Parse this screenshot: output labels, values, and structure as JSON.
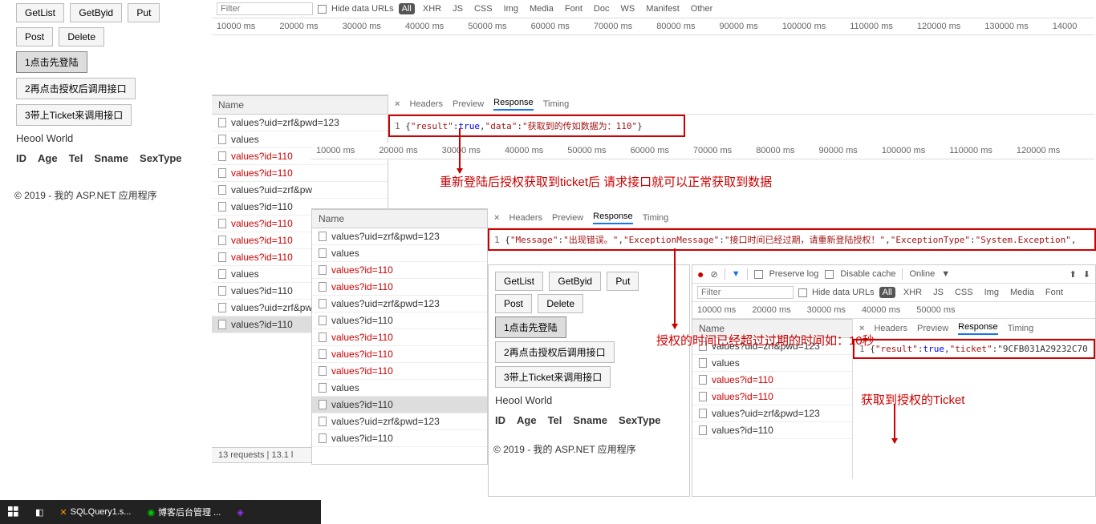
{
  "app": {
    "buttons": {
      "getlist": "GetList",
      "getbyid": "GetByid",
      "put": "Put",
      "post": "Post",
      "delete": "Delete",
      "step1": "1点击先登陆",
      "step2": "2再点击授权后调用接口",
      "step3": "3带上Ticket来调用接口"
    },
    "heool": "Heool World",
    "tbl_headers": [
      "ID",
      "Age",
      "Tel",
      "Sname",
      "SexType"
    ],
    "copyright": "© 2019 - 我的 ASP.NET 应用程序"
  },
  "filter": {
    "placeholder": "Filter",
    "hide_data_urls": "Hide data URLs",
    "types": [
      "All",
      "XHR",
      "JS",
      "CSS",
      "Img",
      "Media",
      "Font",
      "Doc",
      "WS",
      "Manifest",
      "Other"
    ]
  },
  "waterfall_main": [
    "10000 ms",
    "20000 ms",
    "30000 ms",
    "40000 ms",
    "50000 ms",
    "60000 ms",
    "70000 ms",
    "80000 ms",
    "90000 ms",
    "100000 ms",
    "110000 ms",
    "120000 ms",
    "130000 ms",
    "14000"
  ],
  "waterfall_mid": [
    "10000 ms",
    "20000 ms",
    "30000 ms",
    "40000 ms",
    "50000 ms",
    "60000 ms",
    "70000 ms",
    "80000 ms",
    "90000 ms",
    "100000 ms",
    "110000 ms",
    "120000 ms"
  ],
  "waterfall_sm": [
    "10000 ms",
    "20000 ms",
    "30000 ms",
    "40000 ms",
    "50000 ms"
  ],
  "name_label": "Name",
  "resp_tabs": {
    "close": "×",
    "headers": "Headers",
    "preview": "Preview",
    "response": "Response",
    "timing": "Timing"
  },
  "reqs_left": [
    {
      "t": "values?uid=zrf&pwd=123",
      "r": false,
      "sel": false
    },
    {
      "t": "values",
      "r": false,
      "sel": false
    },
    {
      "t": "values?id=110",
      "r": true,
      "sel": false
    },
    {
      "t": "values?id=110",
      "r": true,
      "sel": false
    },
    {
      "t": "values?uid=zrf&pw",
      "r": false,
      "sel": false
    },
    {
      "t": "values?id=110",
      "r": false,
      "sel": false
    },
    {
      "t": "values?id=110",
      "r": true,
      "sel": false
    },
    {
      "t": "values?id=110",
      "r": true,
      "sel": false
    },
    {
      "t": "values?id=110",
      "r": true,
      "sel": false
    },
    {
      "t": "values",
      "r": false,
      "sel": false
    },
    {
      "t": "values?id=110",
      "r": false,
      "sel": false
    },
    {
      "t": "values?uid=zrf&pw",
      "r": false,
      "sel": false
    },
    {
      "t": "values?id=110",
      "r": false,
      "sel": true
    }
  ],
  "status_left": "13 requests   |   13.1 l",
  "reqs_mid": [
    {
      "t": "values?uid=zrf&pwd=123",
      "r": false,
      "sel": false
    },
    {
      "t": "values",
      "r": false,
      "sel": false
    },
    {
      "t": "values?id=110",
      "r": true,
      "sel": false
    },
    {
      "t": "values?id=110",
      "r": true,
      "sel": false
    },
    {
      "t": "values?uid=zrf&pwd=123",
      "r": false,
      "sel": false
    },
    {
      "t": "values?id=110",
      "r": false,
      "sel": false
    },
    {
      "t": "values?id=110",
      "r": true,
      "sel": false
    },
    {
      "t": "values?id=110",
      "r": true,
      "sel": false
    },
    {
      "t": "values?id=110",
      "r": true,
      "sel": false
    },
    {
      "t": "values",
      "r": false,
      "sel": false
    },
    {
      "t": "values?id=110",
      "r": false,
      "sel": true
    },
    {
      "t": "values?uid=zrf&pwd=123",
      "r": false,
      "sel": false
    },
    {
      "t": "values?id=110",
      "r": false,
      "sel": false
    }
  ],
  "reqs_sm": [
    {
      "t": "values?uid=zrf&pwd=123",
      "r": false,
      "sel": false
    },
    {
      "t": "values",
      "r": false,
      "sel": false
    },
    {
      "t": "values?id=110",
      "r": true,
      "sel": false
    },
    {
      "t": "values?id=110",
      "r": true,
      "sel": false
    },
    {
      "t": "values?uid=zrf&pwd=123",
      "r": false,
      "sel": false
    },
    {
      "t": "values?id=110",
      "r": false,
      "sel": false
    }
  ],
  "resp1": {
    "line": "1",
    "json": "{\"result\":true,\"data\":\"获取到的传如数据为：110\"}"
  },
  "resp2": {
    "line": "1",
    "json": "{\"Message\":\"出现错误。\",\"ExceptionMessage\":\"接口时间已经过期，请重新登陆授权！\",\"ExceptionType\":\"System.Exception\","
  },
  "resp3": {
    "line": "1",
    "json": "{\"result\":true,\"ticket\":\"9CFB031A29232C70"
  },
  "toolbar_sm": {
    "preserve": "Preserve log",
    "disable": "Disable cache",
    "online": "Online"
  },
  "anno1": "重新登陆后授权获取到ticket后 请求接口就可以正常获取到数据",
  "anno2": "授权的时间已经超过过期的时间如：10秒",
  "anno3": "获取到授权的Ticket",
  "taskbar": {
    "sql": "SQLQuery1.s...",
    "blog": "博客后台管理 ..."
  }
}
